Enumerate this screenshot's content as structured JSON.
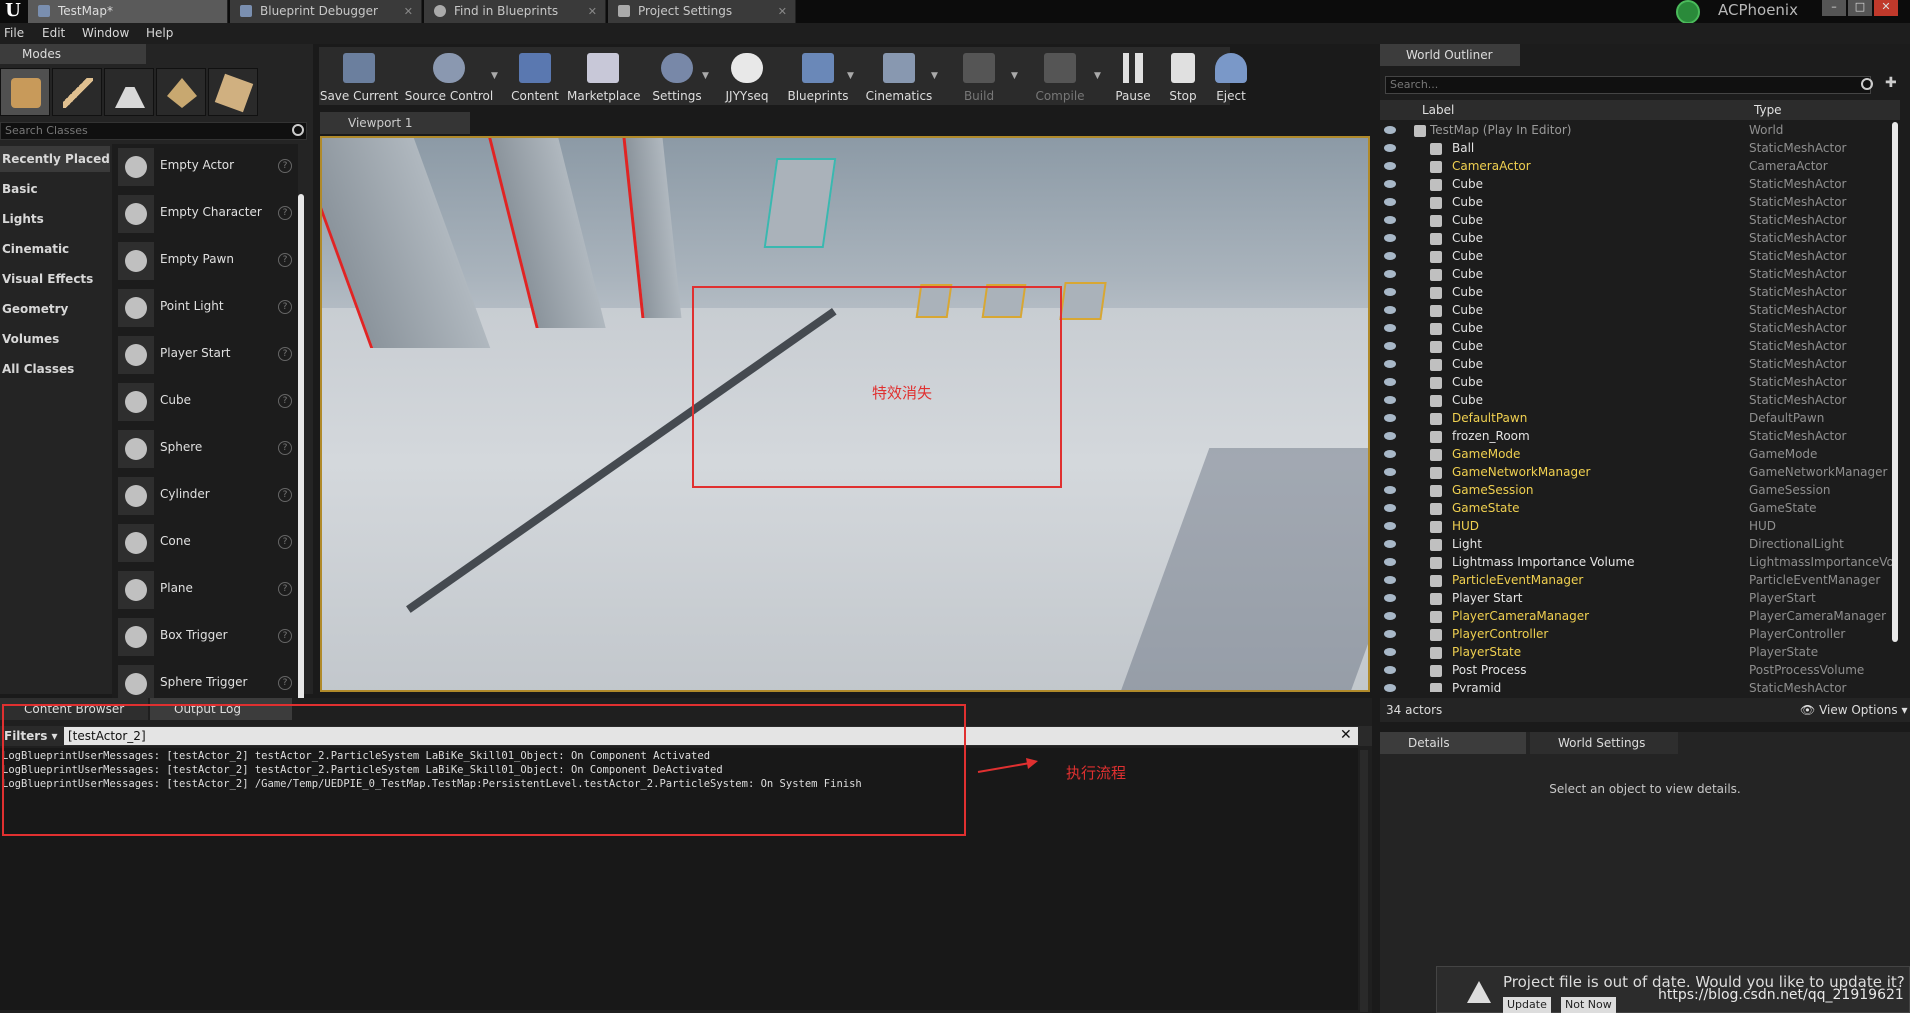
{
  "titlebar": {
    "tabs": [
      {
        "label": "TestMap*",
        "active": true
      },
      {
        "label": "Blueprint Debugger",
        "active": false
      },
      {
        "label": "Find in Blueprints",
        "active": false
      },
      {
        "label": "Project Settings",
        "active": false
      }
    ],
    "user": "ACPhoenix"
  },
  "menu": [
    "File",
    "Edit",
    "Window",
    "Help"
  ],
  "modes": {
    "tab_label": "Modes",
    "search_placeholder": "Search Classes",
    "categories": [
      "Recently Placed",
      "Basic",
      "Lights",
      "Cinematic",
      "Visual Effects",
      "Geometry",
      "Volumes",
      "All Classes"
    ],
    "active_category": "Recently Placed",
    "items": [
      "Empty Actor",
      "Empty Character",
      "Empty Pawn",
      "Point Light",
      "Player Start",
      "Cube",
      "Sphere",
      "Cylinder",
      "Cone",
      "Plane",
      "Box Trigger",
      "Sphere Trigger"
    ]
  },
  "toolbar": {
    "save_current": "Save Current",
    "source_control": "Source Control",
    "content": "Content",
    "marketplace": "Marketplace",
    "settings": "Settings",
    "jjyyseq": "JJYYseq",
    "blueprints": "Blueprints",
    "cinematics": "Cinematics",
    "build": "Build",
    "compile": "Compile",
    "pause": "Pause",
    "stop": "Stop",
    "eject": "Eject"
  },
  "viewport": {
    "tab_label": "Viewport 1",
    "annotation": "特效消失"
  },
  "outliner": {
    "tab_label": "World Outliner",
    "search_placeholder": "Search...",
    "col_label": "Label",
    "col_type": "Type",
    "rows": [
      {
        "name": "TestMap (Play In Editor)",
        "type": "World"
      },
      {
        "name": "Ball",
        "type": "StaticMeshActor"
      },
      {
        "name": "CameraActor",
        "type": "CameraActor"
      },
      {
        "name": "Cube",
        "type": "StaticMeshActor"
      },
      {
        "name": "Cube",
        "type": "StaticMeshActor"
      },
      {
        "name": "Cube",
        "type": "StaticMeshActor"
      },
      {
        "name": "Cube",
        "type": "StaticMeshActor"
      },
      {
        "name": "Cube",
        "type": "StaticMeshActor"
      },
      {
        "name": "Cube",
        "type": "StaticMeshActor"
      },
      {
        "name": "Cube",
        "type": "StaticMeshActor"
      },
      {
        "name": "Cube",
        "type": "StaticMeshActor"
      },
      {
        "name": "Cube",
        "type": "StaticMeshActor"
      },
      {
        "name": "Cube",
        "type": "StaticMeshActor"
      },
      {
        "name": "Cube",
        "type": "StaticMeshActor"
      },
      {
        "name": "Cube",
        "type": "StaticMeshActor"
      },
      {
        "name": "Cube",
        "type": "StaticMeshActor"
      },
      {
        "name": "DefaultPawn",
        "type": "DefaultPawn"
      },
      {
        "name": "frozen_Room",
        "type": "StaticMeshActor"
      },
      {
        "name": "GameMode",
        "type": "GameMode"
      },
      {
        "name": "GameNetworkManager",
        "type": "GameNetworkManager"
      },
      {
        "name": "GameSession",
        "type": "GameSession"
      },
      {
        "name": "GameState",
        "type": "GameState"
      },
      {
        "name": "HUD",
        "type": "HUD"
      },
      {
        "name": "Light",
        "type": "DirectionalLight"
      },
      {
        "name": "Lightmass Importance Volume",
        "type": "LightmassImportanceVolu"
      },
      {
        "name": "ParticleEventManager",
        "type": "ParticleEventManager"
      },
      {
        "name": "Player Start",
        "type": "PlayerStart"
      },
      {
        "name": "PlayerCameraManager",
        "type": "PlayerCameraManager"
      },
      {
        "name": "PlayerController",
        "type": "PlayerController"
      },
      {
        "name": "PlayerState",
        "type": "PlayerState"
      },
      {
        "name": "Post Process",
        "type": "PostProcessVolume"
      },
      {
        "name": "Pyramid",
        "type": "StaticMeshActor"
      }
    ],
    "count": "34 actors",
    "view_options": "View Options"
  },
  "details": {
    "tab_details": "Details",
    "tab_world_settings": "World Settings",
    "empty_message": "Select an object to view details."
  },
  "bottom": {
    "tab_content_browser": "Content Browser",
    "tab_output_log": "Output Log",
    "filters_label": "Filters",
    "filter_value": "[testActor_2]",
    "log_lines": [
      "LogBlueprintUserMessages: [testActor_2] testActor_2.ParticleSystem LaBiKe_Skill01_Object: On Component Activated",
      "LogBlueprintUserMessages: [testActor_2] testActor_2.ParticleSystem LaBiKe_Skill01_Object: On Component DeActivated",
      "LogBlueprintUserMessages: [testActor_2] /Game/Temp/UEDPIE_0_TestMap.TestMap:PersistentLevel.testActor_2.ParticleSystem: On System Finish"
    ],
    "annotation": "执行流程"
  },
  "notification": {
    "text": "Project file is out of date. Would you like to update it?",
    "update": "Update",
    "not_now": "Not Now"
  },
  "watermark": "https://blog.csdn.net/qq_21919621",
  "colors": {
    "annotation_red": "#e03030",
    "blueprint_yellow": "#f0d050",
    "selection_outline": "#b08a2a"
  }
}
